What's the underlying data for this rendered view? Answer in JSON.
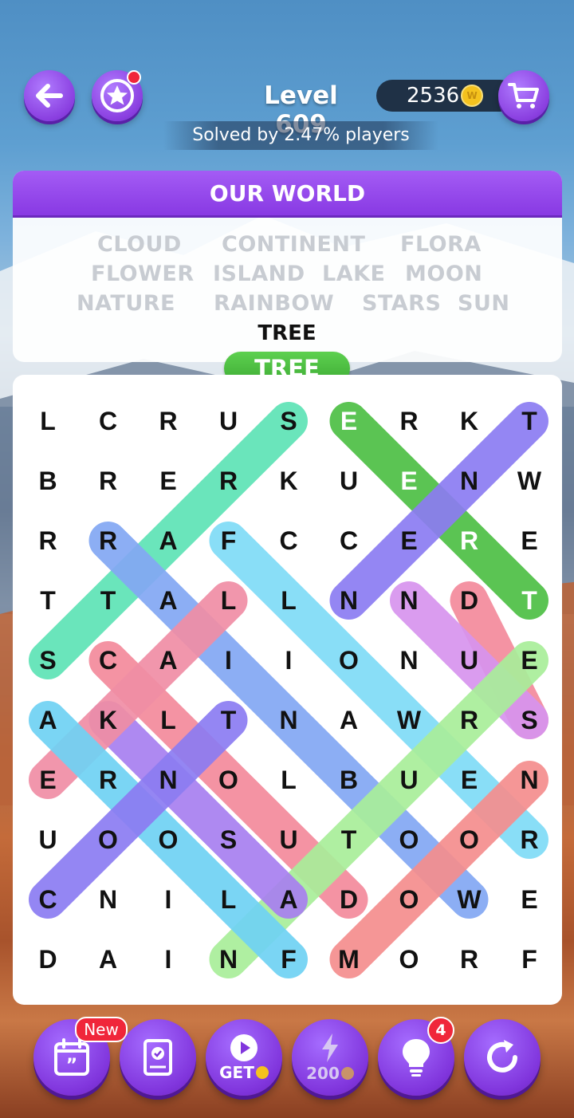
{
  "header": {
    "level_title": "Level 609",
    "coins": "2536",
    "coin_symbol": "W",
    "solved_text": "Solved by 2.47% players"
  },
  "words_panel": {
    "theme": "OUR WORLD",
    "words": [
      "CLOUD",
      "CONTINENT",
      "FLORA",
      "FLOWER",
      "ISLAND",
      "LAKE",
      "MOON",
      "NATURE",
      "RAINBOW",
      "STARS",
      "SUN",
      "TREE"
    ],
    "current_word": "TREE"
  },
  "selection": {
    "word": "TREE"
  },
  "grid": {
    "rows": [
      "LCRUSERKT",
      "BRERKUENW",
      "RRAFCCERE",
      "TTALLNNDT",
      "SCAIIONUE",
      "AKLTNAWRS",
      "ERNOLBUEN",
      "UOOSUTOOR",
      "CNILADOWE",
      "DAINFMORF"
    ],
    "highlights": [
      {
        "word": "STARS",
        "color": "#5ee3b6",
        "from": [
          0,
          4
        ],
        "to": [
          4,
          0
        ]
      },
      {
        "word": "TREE",
        "color": "#4ebf45",
        "from": [
          0,
          5
        ],
        "to": [
          3,
          8
        ]
      },
      {
        "word": "TOWN",
        "color": "#8c7cf2",
        "from": [
          0,
          8
        ],
        "to": [
          3,
          5
        ]
      },
      {
        "word": "RAINBOW",
        "color": "#83a8f4",
        "from": [
          2,
          1
        ],
        "to": [
          8,
          7
        ]
      },
      {
        "word": "FLORA",
        "color": "#7fdcf7",
        "from": [
          2,
          3
        ],
        "to": [
          7,
          8
        ]
      },
      {
        "word": "DUES",
        "color": "#f48a9c",
        "from": [
          3,
          7
        ],
        "to": [
          5,
          8
        ]
      },
      {
        "word": "ISLAND",
        "color": "#d794ee",
        "from": [
          3,
          6
        ],
        "to": [
          5,
          8
        ]
      },
      {
        "word": "CLOUD",
        "color": "#f48a9c",
        "from": [
          4,
          1
        ],
        "to": [
          8,
          5
        ]
      },
      {
        "word": "NATURE",
        "color": "#a9ee9a",
        "from": [
          4,
          8
        ],
        "to": [
          9,
          3
        ]
      },
      {
        "word": "KNOT",
        "color": "#a880f0",
        "from": [
          5,
          1
        ],
        "to": [
          8,
          4
        ]
      },
      {
        "word": "LAKE",
        "color": "#f08ea5",
        "from": [
          3,
          3
        ],
        "to": [
          6,
          0
        ]
      },
      {
        "word": "CONTINENT",
        "color": "#6fd2f4",
        "from": [
          5,
          0
        ],
        "to": [
          9,
          4
        ]
      },
      {
        "word": "MOON",
        "color": "#f58e8e",
        "from": [
          9,
          5
        ],
        "to": [
          6,
          8
        ]
      },
      {
        "word": "CLUE",
        "color": "#8c7cf2",
        "from": [
          8,
          0
        ],
        "to": [
          5,
          3
        ]
      }
    ],
    "white_letters": [
      [
        0,
        5
      ],
      [
        1,
        6
      ],
      [
        2,
        7
      ],
      [
        3,
        8
      ]
    ]
  },
  "toolbar": {
    "new_badge": "New",
    "get_label": "GET",
    "zap_label": "200",
    "hint_count": "4"
  }
}
